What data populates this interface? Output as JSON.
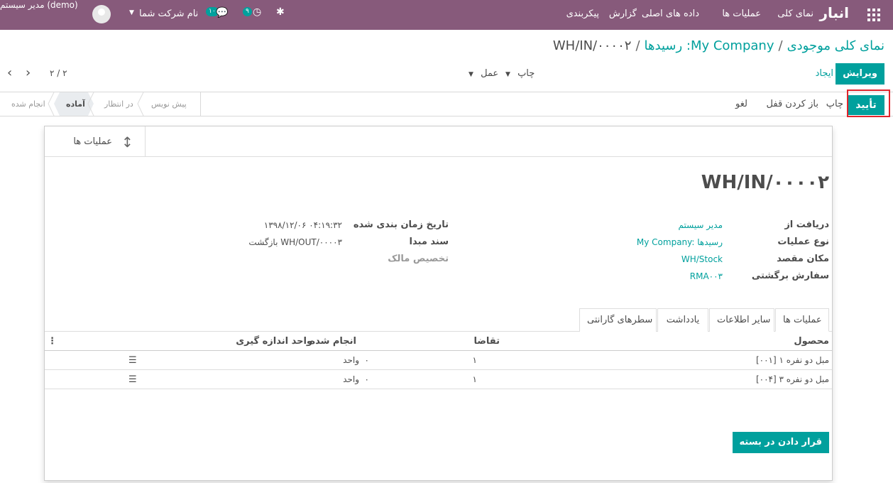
{
  "topbar": {
    "brand": "انبار",
    "menu": [
      "نمای کلی",
      "عملیات ها",
      "داده های اصلی",
      "گزارش",
      "پیکربندی"
    ],
    "user": "مدیر سیستم (demo)",
    "company": "نام شرکت شما",
    "messages_count": "۱۰",
    "activities_count": "۹"
  },
  "breadcrumb": {
    "item1": "نمای کلی موجودی",
    "item2": "My Company: رسیدها",
    "current": "WH/IN/۰۰۰۰۲",
    "sep": "/"
  },
  "controls": {
    "edit": "ویرایش",
    "create": "ایجاد",
    "print": "چاپ",
    "action": "عمل",
    "pager": "۲ / ۲"
  },
  "header_buttons": {
    "confirm": "تأیید",
    "print": "چاپ",
    "unlock": "باز کردن قفل",
    "cancel": "لغو"
  },
  "stages": [
    "پیش نویس",
    "در انتظار",
    "آماده",
    "انجام شده"
  ],
  "active_stage": "آماده",
  "smart_button": {
    "label": "عملیات ها"
  },
  "record": {
    "name": "WH/IN/۰۰۰۰۲",
    "left_fields": [
      {
        "label": "دریافت از",
        "value": "مدیر سیستم"
      },
      {
        "label": "نوع عملیات",
        "value": "My Company: رسیدها"
      },
      {
        "label": "مکان مقصد",
        "value": "WH/Stock"
      },
      {
        "label": "سفارش برگشتی",
        "value": "RMA۰۰۳"
      }
    ],
    "right_fields": [
      {
        "label": "تاریخ زمان بندی شده",
        "value": "۱۳۹۸/۱۲/۰۶ ۰۴:۱۹:۳۲"
      },
      {
        "label": "سند مبدا",
        "value": "بازگشت WH/OUT/۰۰۰۰۳"
      },
      {
        "label": "تخصیص مالک",
        "value": ""
      }
    ]
  },
  "tabs": [
    "عملیات ها",
    "سایر اطلاعات",
    "یادداشت",
    "سطرهای گارانتی"
  ],
  "table": {
    "headers": {
      "product": "محصول",
      "demand": "تقاضا",
      "done": "انجام شده",
      "uom": "واحد اندازه گیری"
    },
    "rows": [
      {
        "product": "[۰۰۱] مبل دو نفره ۱",
        "demand": "۱",
        "done": "۰",
        "uom": "واحد"
      },
      {
        "product": "[۰۰۴] مبل دو نفره ۳",
        "demand": "۱",
        "done": "۰",
        "uom": "واحد"
      }
    ]
  },
  "pack_button": "قرار دادن در بسته",
  "colors": {
    "primary": "#875a7b",
    "accent": "#00a09d",
    "highlight": "#e0252c"
  }
}
